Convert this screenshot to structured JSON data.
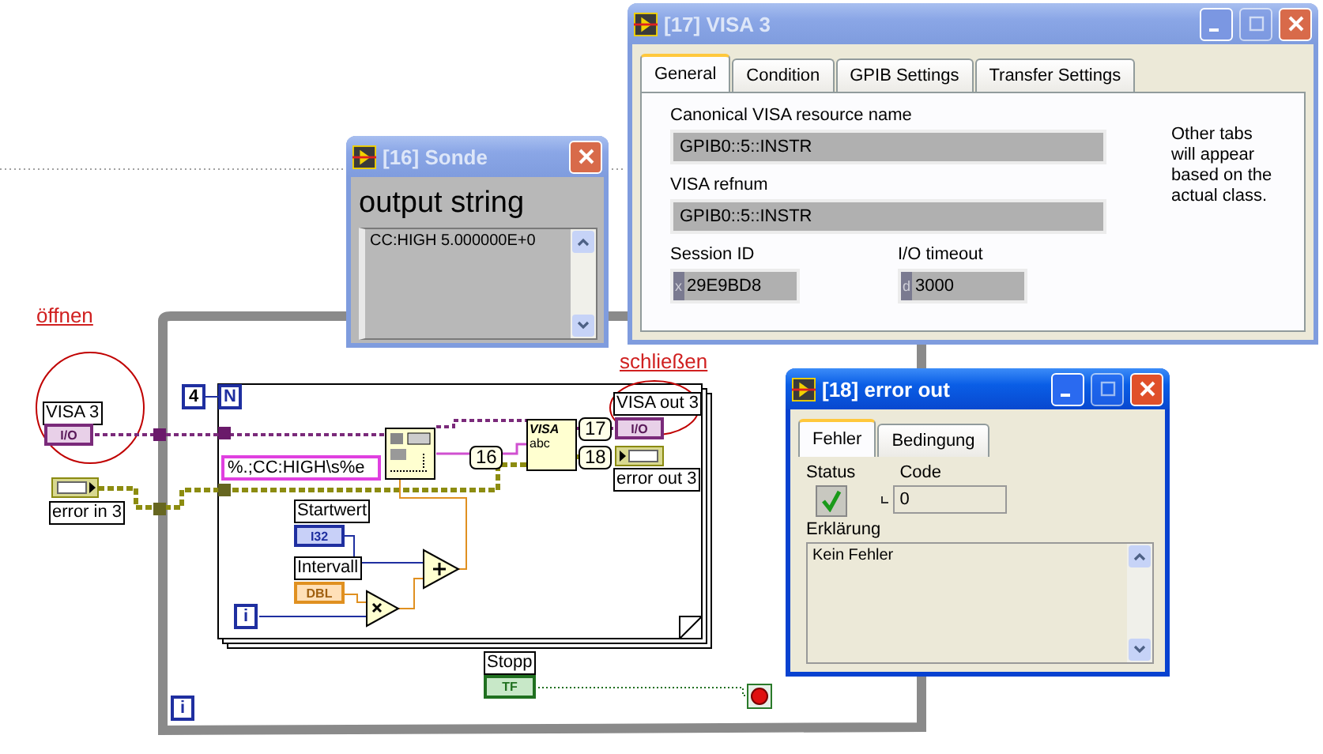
{
  "diagram": {
    "open_note": "öffnen",
    "close_note": "schließen",
    "visa_in": {
      "label": "VISA 3",
      "type": "I/O"
    },
    "error_in": {
      "label": "error in 3"
    },
    "loop_count": "4",
    "count_terminal": "N",
    "for_index": "i",
    "while_index": "i",
    "format_string": "%.;CC:HIGH\\s%e",
    "probes": [
      "16",
      "17",
      "18"
    ],
    "visa_write": {
      "line1": "VISA",
      "line2": "abc"
    },
    "start": {
      "label": "Startwert",
      "type": "I32"
    },
    "interval": {
      "label": "Intervall",
      "type": "DBL"
    },
    "visa_out": {
      "label": "VISA out 3",
      "type": "I/O"
    },
    "error_out": {
      "label": "error out 3"
    },
    "stop": {
      "label": "Stopp",
      "type": "TF"
    }
  },
  "windows": [
    {
      "kind": "visa",
      "title": "[17] VISA 3",
      "active": false,
      "tabs": [
        {
          "label": "General",
          "selected": true
        },
        {
          "label": "Condition",
          "selected": false
        },
        {
          "label": "GPIB Settings",
          "selected": false
        },
        {
          "label": "Transfer Settings",
          "selected": false
        }
      ],
      "fields": [
        {
          "label": "Canonical VISA resource name",
          "value": "GPIB0::5::INSTR"
        },
        {
          "label": "VISA refnum",
          "value": "GPIB0::5::INSTR"
        }
      ],
      "small_fields": [
        {
          "label": "Session ID",
          "radix": "x",
          "value": "29E9BD8"
        },
        {
          "label": "I/O timeout",
          "radix": "d",
          "value": "3000"
        }
      ],
      "note": "Other tabs will appear based on the actual class."
    },
    {
      "kind": "probe",
      "title": "[16] Sonde",
      "active": false,
      "label": "output string",
      "value": "CC:HIGH 5.000000E+0"
    },
    {
      "kind": "error",
      "title": "[18] error out",
      "active": true,
      "tabs": [
        {
          "label": "Fehler",
          "selected": true
        },
        {
          "label": "Bedingung",
          "selected": false
        }
      ],
      "status_label": "Status",
      "status_ok": true,
      "code_label": "Code",
      "code": "0",
      "explanation_label": "Erklärung",
      "explanation": "Kein Fehler"
    }
  ]
}
